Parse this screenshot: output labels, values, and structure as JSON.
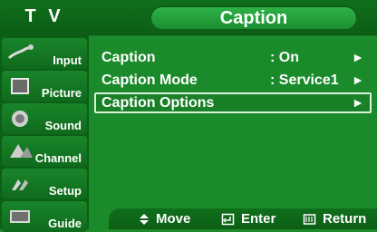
{
  "header": {
    "tv": "T V",
    "title": "Caption"
  },
  "sidebar": {
    "items": [
      {
        "label": "Input",
        "icon": "input-icon"
      },
      {
        "label": "Picture",
        "icon": "picture-icon"
      },
      {
        "label": "Sound",
        "icon": "sound-icon"
      },
      {
        "label": "Channel",
        "icon": "channel-icon"
      },
      {
        "label": "Setup",
        "icon": "setup-icon"
      },
      {
        "label": "Guide",
        "icon": "guide-icon"
      }
    ]
  },
  "menu": {
    "rows": [
      {
        "name": "Caption",
        "value": ": On",
        "arrow": "►"
      },
      {
        "name": "Caption Mode",
        "value": ": Service1",
        "arrow": "►"
      },
      {
        "name": "Caption Options",
        "value": "",
        "arrow": "►"
      }
    ],
    "selected_index": 2
  },
  "footer": {
    "move": "Move",
    "enter": "Enter",
    "return": "Return"
  },
  "colors": {
    "background": "#1b8a2b",
    "bar": "#0f6f1b",
    "text": "#ffffff"
  }
}
